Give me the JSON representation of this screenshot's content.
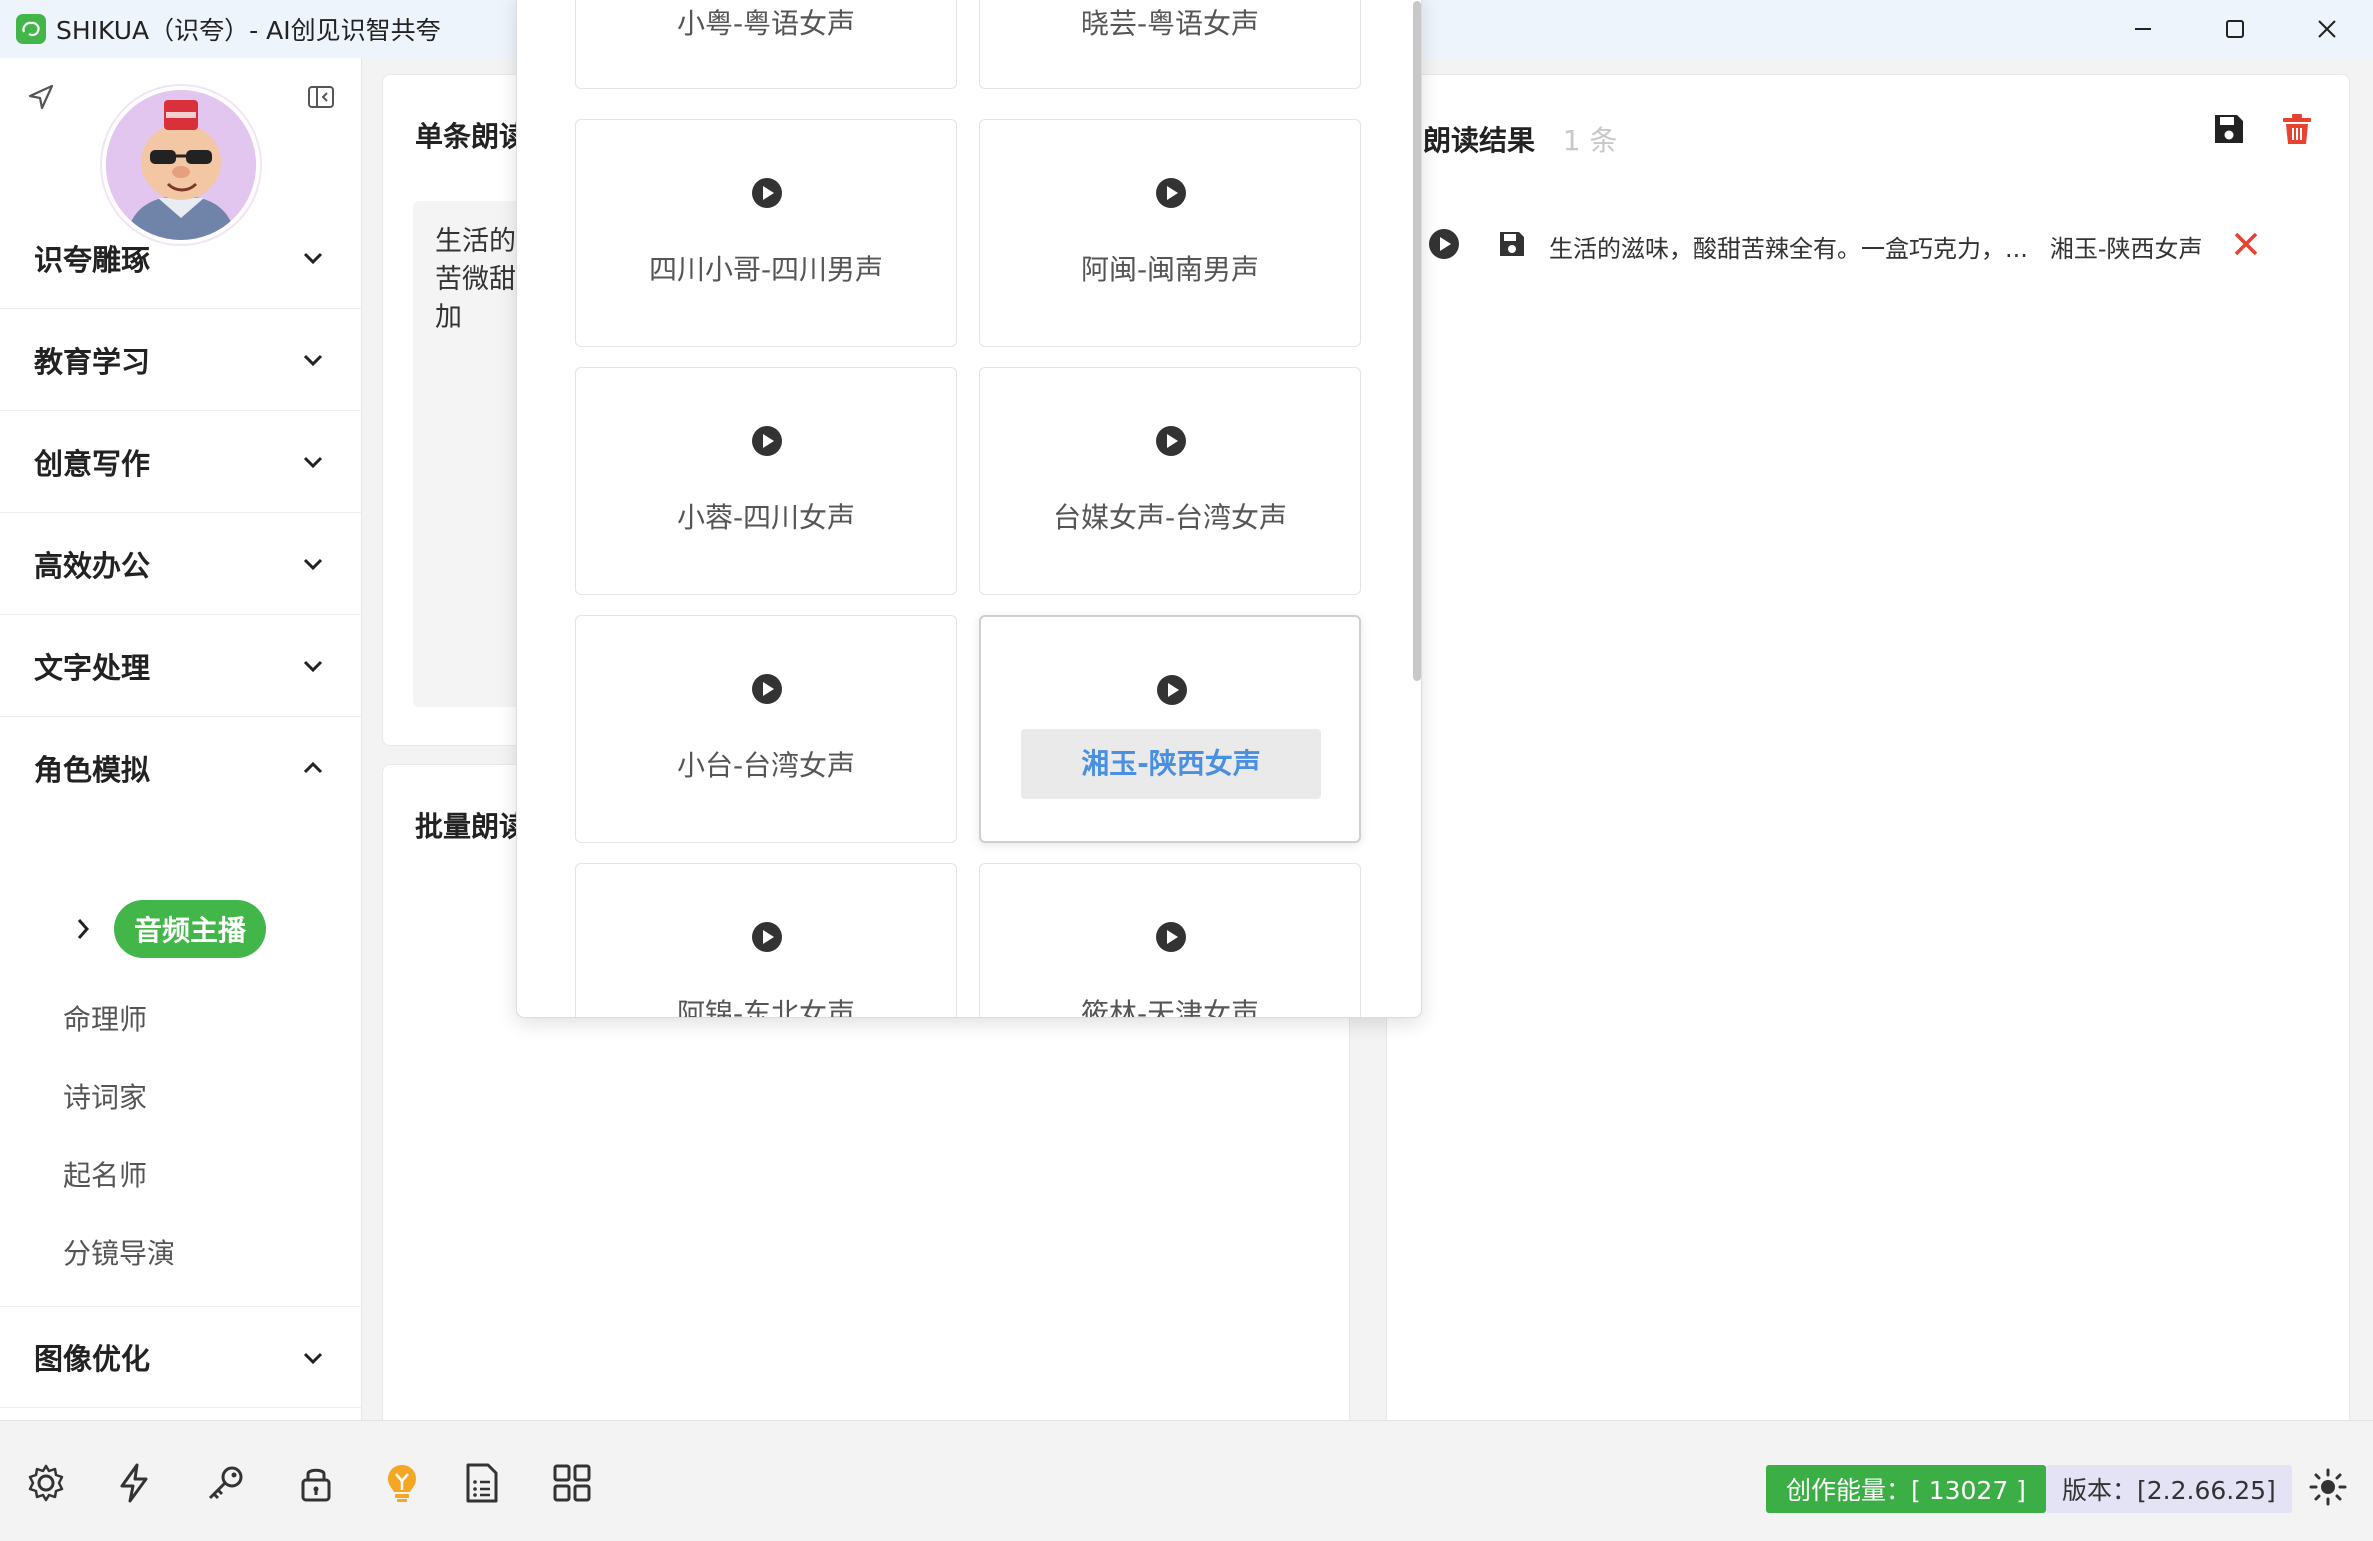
{
  "window": {
    "title": "SHIKUA（识夸）- AI创见识智共夸"
  },
  "sidebar": {
    "categories": [
      {
        "label": "识夸雕琢"
      },
      {
        "label": "教育学习"
      },
      {
        "label": "创意写作"
      },
      {
        "label": "高效办公"
      },
      {
        "label": "文字处理"
      },
      {
        "label": "角色模拟"
      },
      {
        "label": "图像优化"
      }
    ],
    "role_items": {
      "active": "音频主播",
      "others": [
        "命理师",
        "诗词家",
        "起名师",
        "分镜导演"
      ]
    }
  },
  "main": {
    "single": {
      "title": "单条朗读",
      "text": "生活的滋味，酸甜苦辣全有。一盒巧克力，微苦微甜，口感丝滑，回味浓郁；咬一口香脆；加"
    },
    "batch": {
      "title": "批量朗读"
    },
    "results": {
      "title": "朗读结果",
      "count": "1 条",
      "rows": [
        {
          "text": "生活的滋味，酸甜苦辣全有。一盒巧克力，...",
          "voice": "湘玉-陕西女声"
        }
      ]
    }
  },
  "voice_picker": {
    "voices": [
      {
        "label": "小粤-粤语女声"
      },
      {
        "label": "晓芸-粤语女声"
      },
      {
        "label": "四川小哥-四川男声"
      },
      {
        "label": "阿闽-闽南男声"
      },
      {
        "label": "小蓉-四川女声"
      },
      {
        "label": "台媒女声-台湾女声"
      },
      {
        "label": "小台-台湾女声"
      },
      {
        "label": "湘玉-陕西女声"
      },
      {
        "label": "阿锦-东北女声"
      },
      {
        "label": "筱林-天津女声"
      }
    ],
    "selected": "湘玉-陕西女声"
  },
  "statusbar": {
    "energy": "创作能量：[ 13027 ]",
    "version": "版本：[2.2.66.25]"
  },
  "colors": {
    "accent_green": "#43b649",
    "selected_voice_text": "#4a90e2",
    "delete_red": "#e8412e"
  }
}
